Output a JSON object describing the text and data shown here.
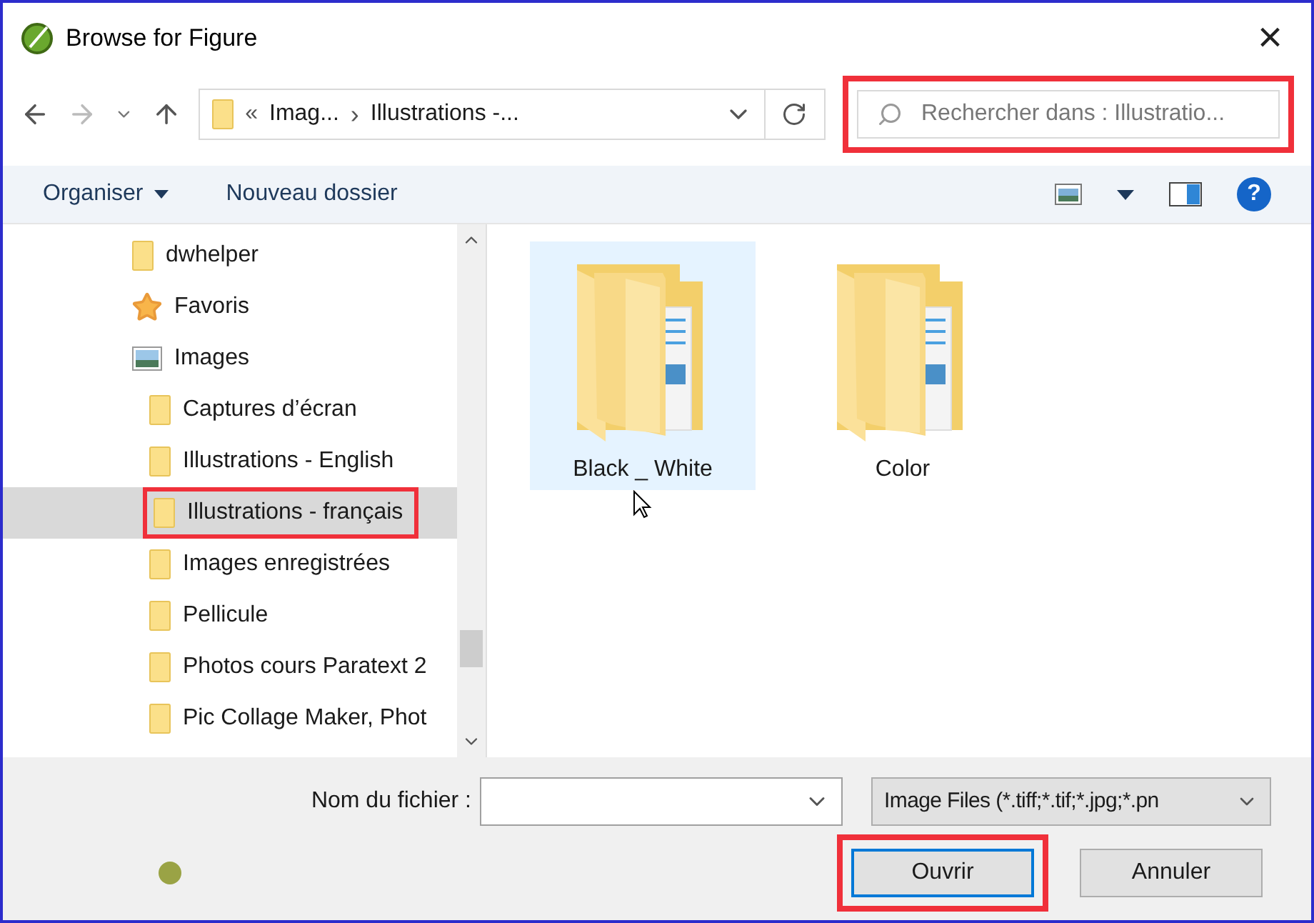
{
  "window": {
    "title": "Browse for Figure",
    "close": "×"
  },
  "address": {
    "separator_start": "«",
    "crumbs": [
      "Imag...",
      "Illustrations -..."
    ],
    "separator": "›"
  },
  "search": {
    "placeholder": "Rechercher dans : Illustratio...",
    "highlight": true
  },
  "toolbar": {
    "items": [
      "Organiser",
      "Nouveau dossier"
    ],
    "help": "?"
  },
  "tree": [
    {
      "label": "dwhelper",
      "kind": "folder",
      "selected": false,
      "highlight": false
    },
    {
      "label": "Favoris",
      "kind": "star",
      "selected": false,
      "highlight": false
    },
    {
      "label": "Images",
      "kind": "pictures",
      "selected": false,
      "highlight": false,
      "children": [
        {
          "label": "Captures d’écran",
          "kind": "folder",
          "selected": false,
          "highlight": false
        },
        {
          "label": "Illustrations - English",
          "kind": "folder",
          "selected": false,
          "highlight": false
        },
        {
          "label": "Illustrations - français",
          "kind": "folder",
          "selected": true,
          "highlight": true
        },
        {
          "label": "Images enregistrées",
          "kind": "folder",
          "selected": false,
          "highlight": false
        },
        {
          "label": "Pellicule",
          "kind": "folder",
          "selected": false,
          "highlight": false
        },
        {
          "label": "Photos cours Paratext 2",
          "kind": "folder",
          "selected": false,
          "highlight": false
        },
        {
          "label": "Pic Collage Maker, Phot",
          "kind": "folder",
          "selected": false,
          "highlight": false
        }
      ]
    }
  ],
  "files": [
    {
      "label": "Black _ White",
      "selected": true
    },
    {
      "label": "Color",
      "selected": false
    }
  ],
  "footer": {
    "filename_label": "Nom du fichier :",
    "filter": "Image Files (*.tiff;*.tif;*.jpg;*.pn",
    "buttons": [
      {
        "label": "Ouvrir",
        "kind": "primary",
        "highlight": true
      },
      {
        "label": "Annuler",
        "kind": "secondary",
        "highlight": false
      }
    ]
  }
}
